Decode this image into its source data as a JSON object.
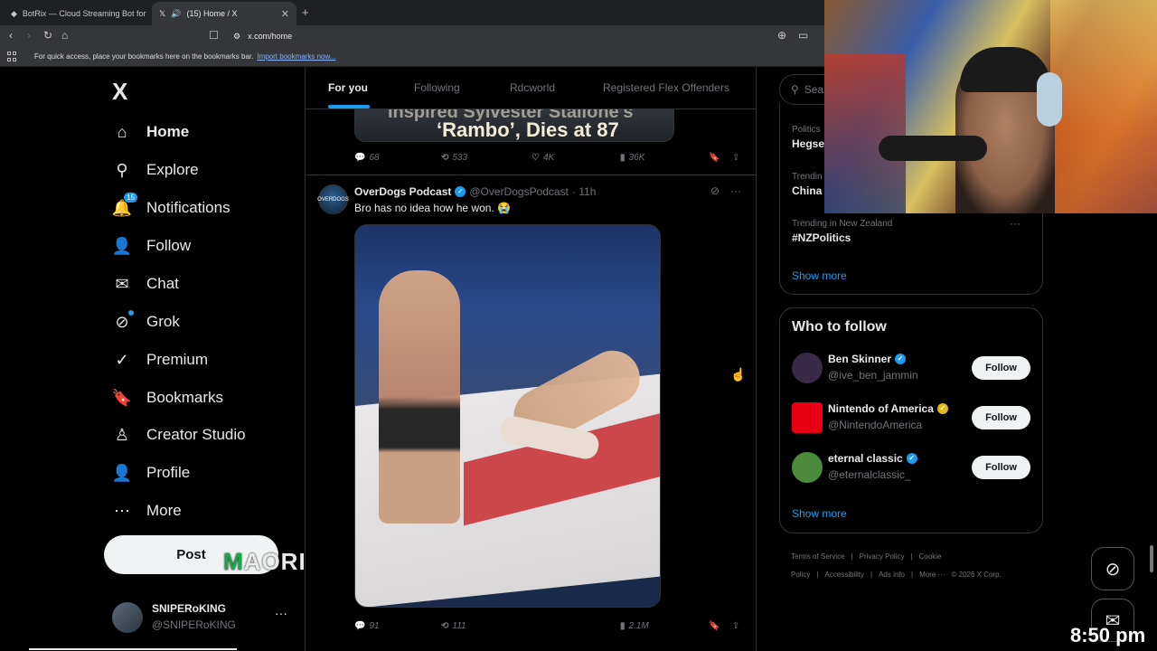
{
  "browser": {
    "tabs": [
      {
        "label": "BotRix — Cloud Streaming Bot for Tw",
        "active": false
      },
      {
        "label": "(15) Home / X",
        "active": true
      }
    ],
    "url": "x.com/home",
    "bookmarks_prompt": "For quick access, place your bookmarks here on the bookmarks bar.",
    "import_link": "Import bookmarks now..."
  },
  "nav": {
    "logo": "X",
    "items": [
      {
        "label": "Home",
        "icon": "home-icon",
        "glyph": "⌂"
      },
      {
        "label": "Explore",
        "icon": "search-icon",
        "glyph": "⚲"
      },
      {
        "label": "Notifications",
        "icon": "bell-icon",
        "glyph": "🔔",
        "badge": "15"
      },
      {
        "label": "Follow",
        "icon": "add-user-icon",
        "glyph": "👤"
      },
      {
        "label": "Chat",
        "icon": "mail-icon",
        "glyph": "✉"
      },
      {
        "label": "Grok",
        "icon": "grok-icon",
        "glyph": "⊘"
      },
      {
        "label": "Premium",
        "icon": "premium-icon",
        "glyph": "✓"
      },
      {
        "label": "Bookmarks",
        "icon": "bookmark-icon",
        "glyph": "🔖"
      },
      {
        "label": "Creator Studio",
        "icon": "creator-icon",
        "glyph": "♙"
      },
      {
        "label": "Profile",
        "icon": "profile-icon",
        "glyph": "👤"
      },
      {
        "label": "More",
        "icon": "more-icon",
        "glyph": "⋯"
      }
    ],
    "post_label": "Post",
    "account": {
      "name": "SNIPERoKING",
      "handle": "@SNIPERoKING"
    }
  },
  "feed": {
    "tabs": [
      "For you",
      "Following",
      "Rdcworld",
      "Registered Flex Offenders"
    ],
    "prev_tweet": {
      "media_line1": "Inspired Sylvester Stallone's",
      "media_line2": "‘Rambo’, Dies at 87",
      "replies": "68",
      "reposts": "533",
      "likes": "4K",
      "views": "36K"
    },
    "tweet": {
      "avatar_text": "OVERDOGS",
      "name": "OverDogs Podcast",
      "handle": "@OverDogsPodcast",
      "time": "· 11h",
      "text": "Bro has no idea how he won. 😭",
      "replies": "91",
      "reposts": "111",
      "views": "2.1M"
    }
  },
  "sidebar": {
    "search_placeholder": "Search",
    "trends": [
      {
        "context": "Politics",
        "title": "Hegse"
      },
      {
        "context": "Trendin",
        "title": "China"
      },
      {
        "context": "Trending in New Zealand",
        "title": "#NZPolitics"
      }
    ],
    "trends_show_more": "Show more",
    "who_to_follow_title": "Who to follow",
    "suggestions": [
      {
        "name": "Ben Skinner",
        "handle": "@ive_ben_jammin",
        "verified": "blue",
        "avatar_color": "#3a2a4a"
      },
      {
        "name": "Nintendo of America",
        "handle": "@NintendoAmerica",
        "verified": "gold",
        "avatar_color": "#e60012"
      },
      {
        "name": "eternal classic",
        "handle": "@eternalclassic_",
        "verified": "blue",
        "avatar_color": "#4a8a3a"
      }
    ],
    "follow_label": "Follow",
    "wtf_show_more": "Show more",
    "footer": [
      "Terms of Service",
      "|",
      "Privacy Policy",
      "|",
      "Cookie Policy",
      "|",
      "Accessibility",
      "|",
      "Ads info",
      "|",
      "More ···",
      "© 2026 X Corp."
    ]
  },
  "overlay": {
    "watermark_m": "M",
    "watermark_rest": "AORI",
    "clock": "8:50 pm"
  },
  "colors": {
    "accent": "#1d9bf0",
    "background": "#000000",
    "border": "#2f3336",
    "muted": "#71767b"
  }
}
